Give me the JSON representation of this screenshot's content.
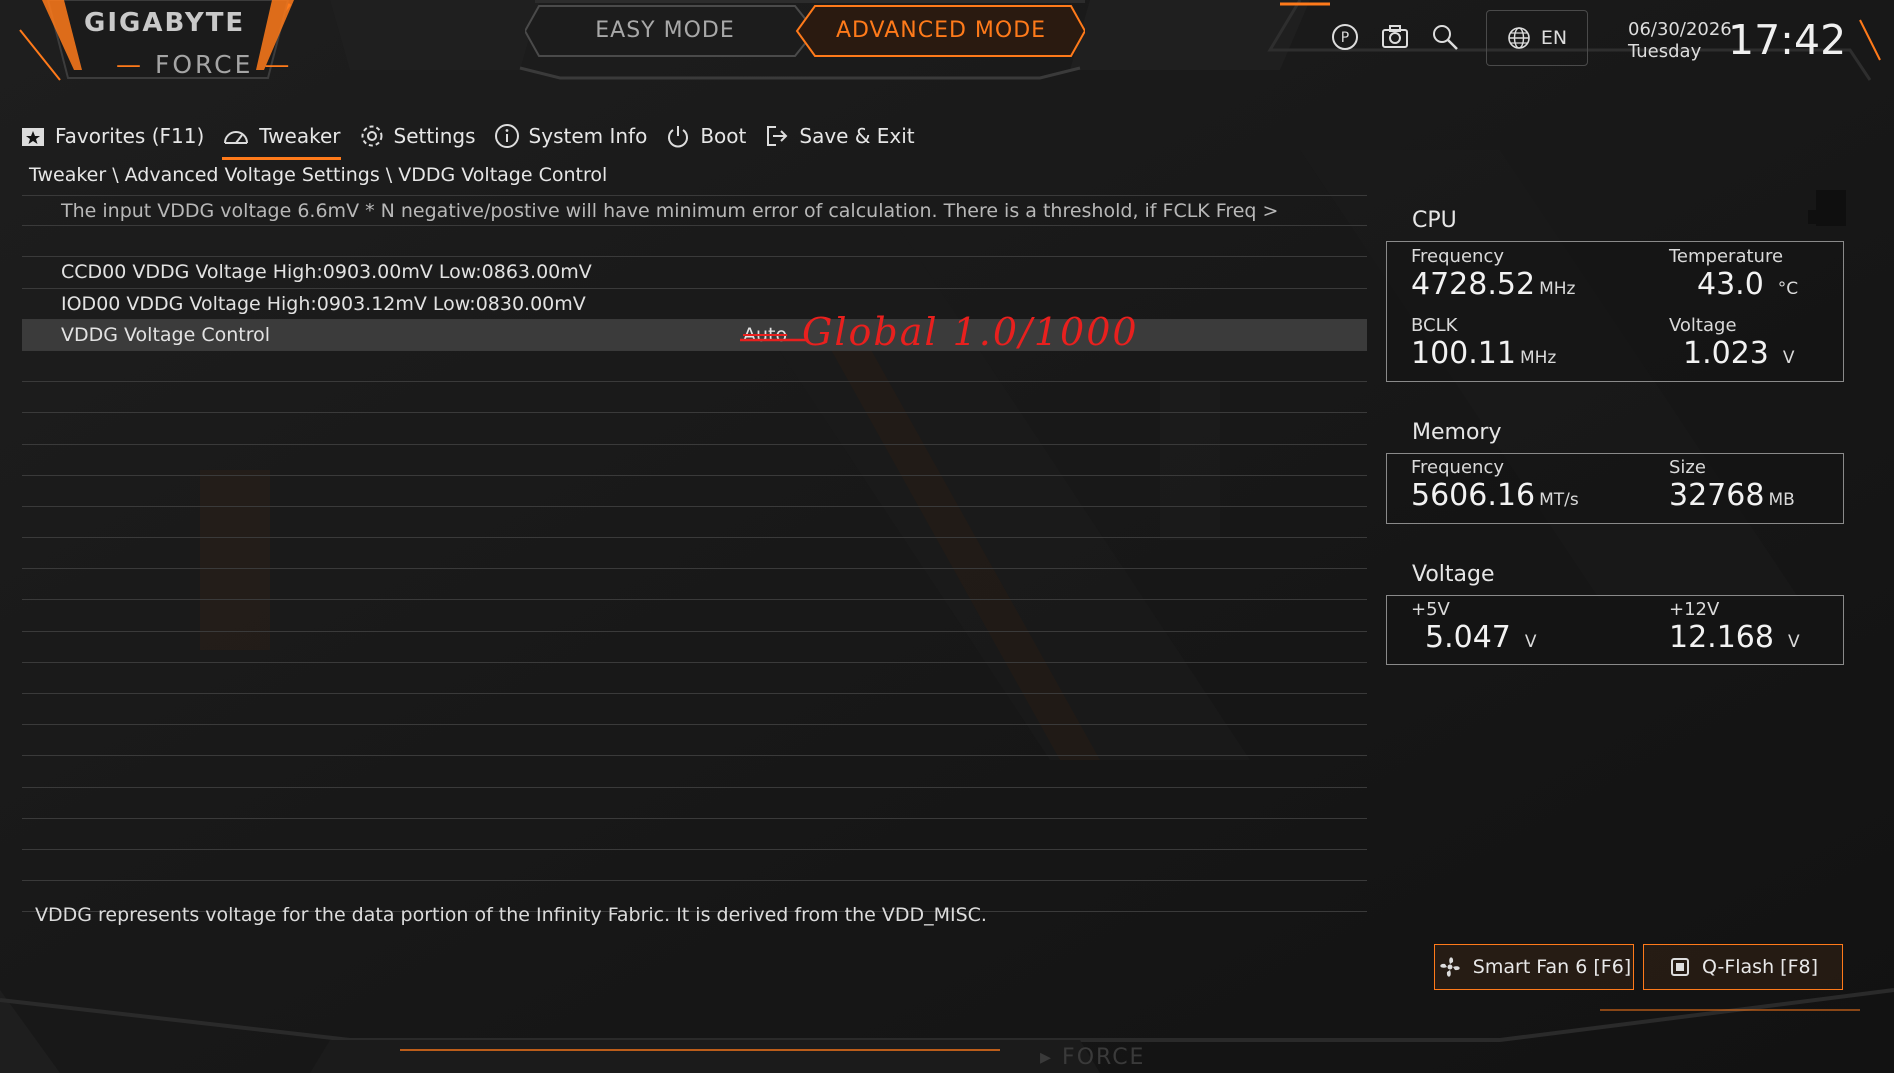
{
  "header": {
    "brand": "GIGABYTE",
    "brand_sub": "FORCE",
    "easy_mode": "EASY MODE",
    "advanced_mode": "ADVANCED MODE",
    "language": "EN",
    "date": "06/30/2026",
    "weekday": "Tuesday",
    "time": "17:42",
    "accent_color": "#ff7a1a"
  },
  "nav": {
    "items": [
      {
        "label": "Favorites (F11)",
        "icon": "star-icon"
      },
      {
        "label": "Tweaker",
        "icon": "gauge-icon"
      },
      {
        "label": "Settings",
        "icon": "gear-icon"
      },
      {
        "label": "System Info",
        "icon": "info-icon"
      },
      {
        "label": "Boot",
        "icon": "power-icon"
      },
      {
        "label": "Save & Exit",
        "icon": "exit-icon"
      }
    ],
    "active": "Tweaker"
  },
  "breadcrumb": "Tweaker \\ Advanced Voltage Settings \\ VDDG Voltage Control",
  "settings": {
    "info_text": "The input VDDG voltage 6.6mV * N negative/postive will have minimum error of calculation. There is a threshold, if FCLK Freq >",
    "rows": [
      {
        "label": "CCD00 VDDG Voltage High:0903.00mV Low:0863.00mV"
      },
      {
        "label": "IOD00 VDDG Voltage High:0903.12mV Low:0830.00mV"
      },
      {
        "label": "VDDG Voltage Control",
        "value": "Auto"
      }
    ],
    "annotation": "Global 1.0/1000",
    "description": "VDDG represents voltage for the data portion of the Infinity Fabric. It is derived from the VDD_MISC."
  },
  "cpu": {
    "title": "CPU",
    "frequency_label": "Frequency",
    "frequency": "4728.52",
    "frequency_unit": "MHz",
    "temperature_label": "Temperature",
    "temperature": "43.0",
    "temperature_unit": "°C",
    "bclk_label": "BCLK",
    "bclk": "100.11",
    "bclk_unit": "MHz",
    "voltage_label": "Voltage",
    "voltage": "1.023",
    "voltage_unit": "V"
  },
  "memory": {
    "title": "Memory",
    "frequency_label": "Frequency",
    "frequency": "5606.16",
    "frequency_unit": "MT/s",
    "size_label": "Size",
    "size": "32768",
    "size_unit": "MB"
  },
  "voltage": {
    "title": "Voltage",
    "v5_label": "+5V",
    "v5": "5.047",
    "v5_unit": "V",
    "v12_label": "+12V",
    "v12": "12.168",
    "v12_unit": "V"
  },
  "buttons": {
    "smart_fan": "Smart Fan 6 [F6]",
    "qflash": "Q-Flash [F8]"
  }
}
